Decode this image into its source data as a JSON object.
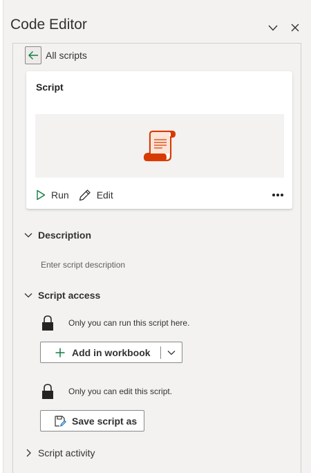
{
  "header": {
    "title": "Code Editor",
    "collapse_icon": "chevron-down-icon",
    "close_icon": "close-icon"
  },
  "nav": {
    "back_label": "All scripts",
    "back_icon": "arrow-left-icon"
  },
  "card": {
    "title": "Script",
    "preview_icon": "script-scroll-icon",
    "run_label": "Run",
    "edit_label": "Edit",
    "more_icon": "more-options-icon"
  },
  "description": {
    "heading": "Description",
    "placeholder": "Enter script description"
  },
  "access": {
    "heading": "Script access",
    "run_permission": "Only you can run this script here.",
    "add_workbook_label": "Add in workbook",
    "edit_permission": "Only you can edit this script.",
    "save_as_label": "Save script as"
  },
  "activity": {
    "heading": "Script activity"
  },
  "colors": {
    "accent_green": "#107c41",
    "script_orange": "#d83b01",
    "pane_bg": "#f3f2f1"
  }
}
